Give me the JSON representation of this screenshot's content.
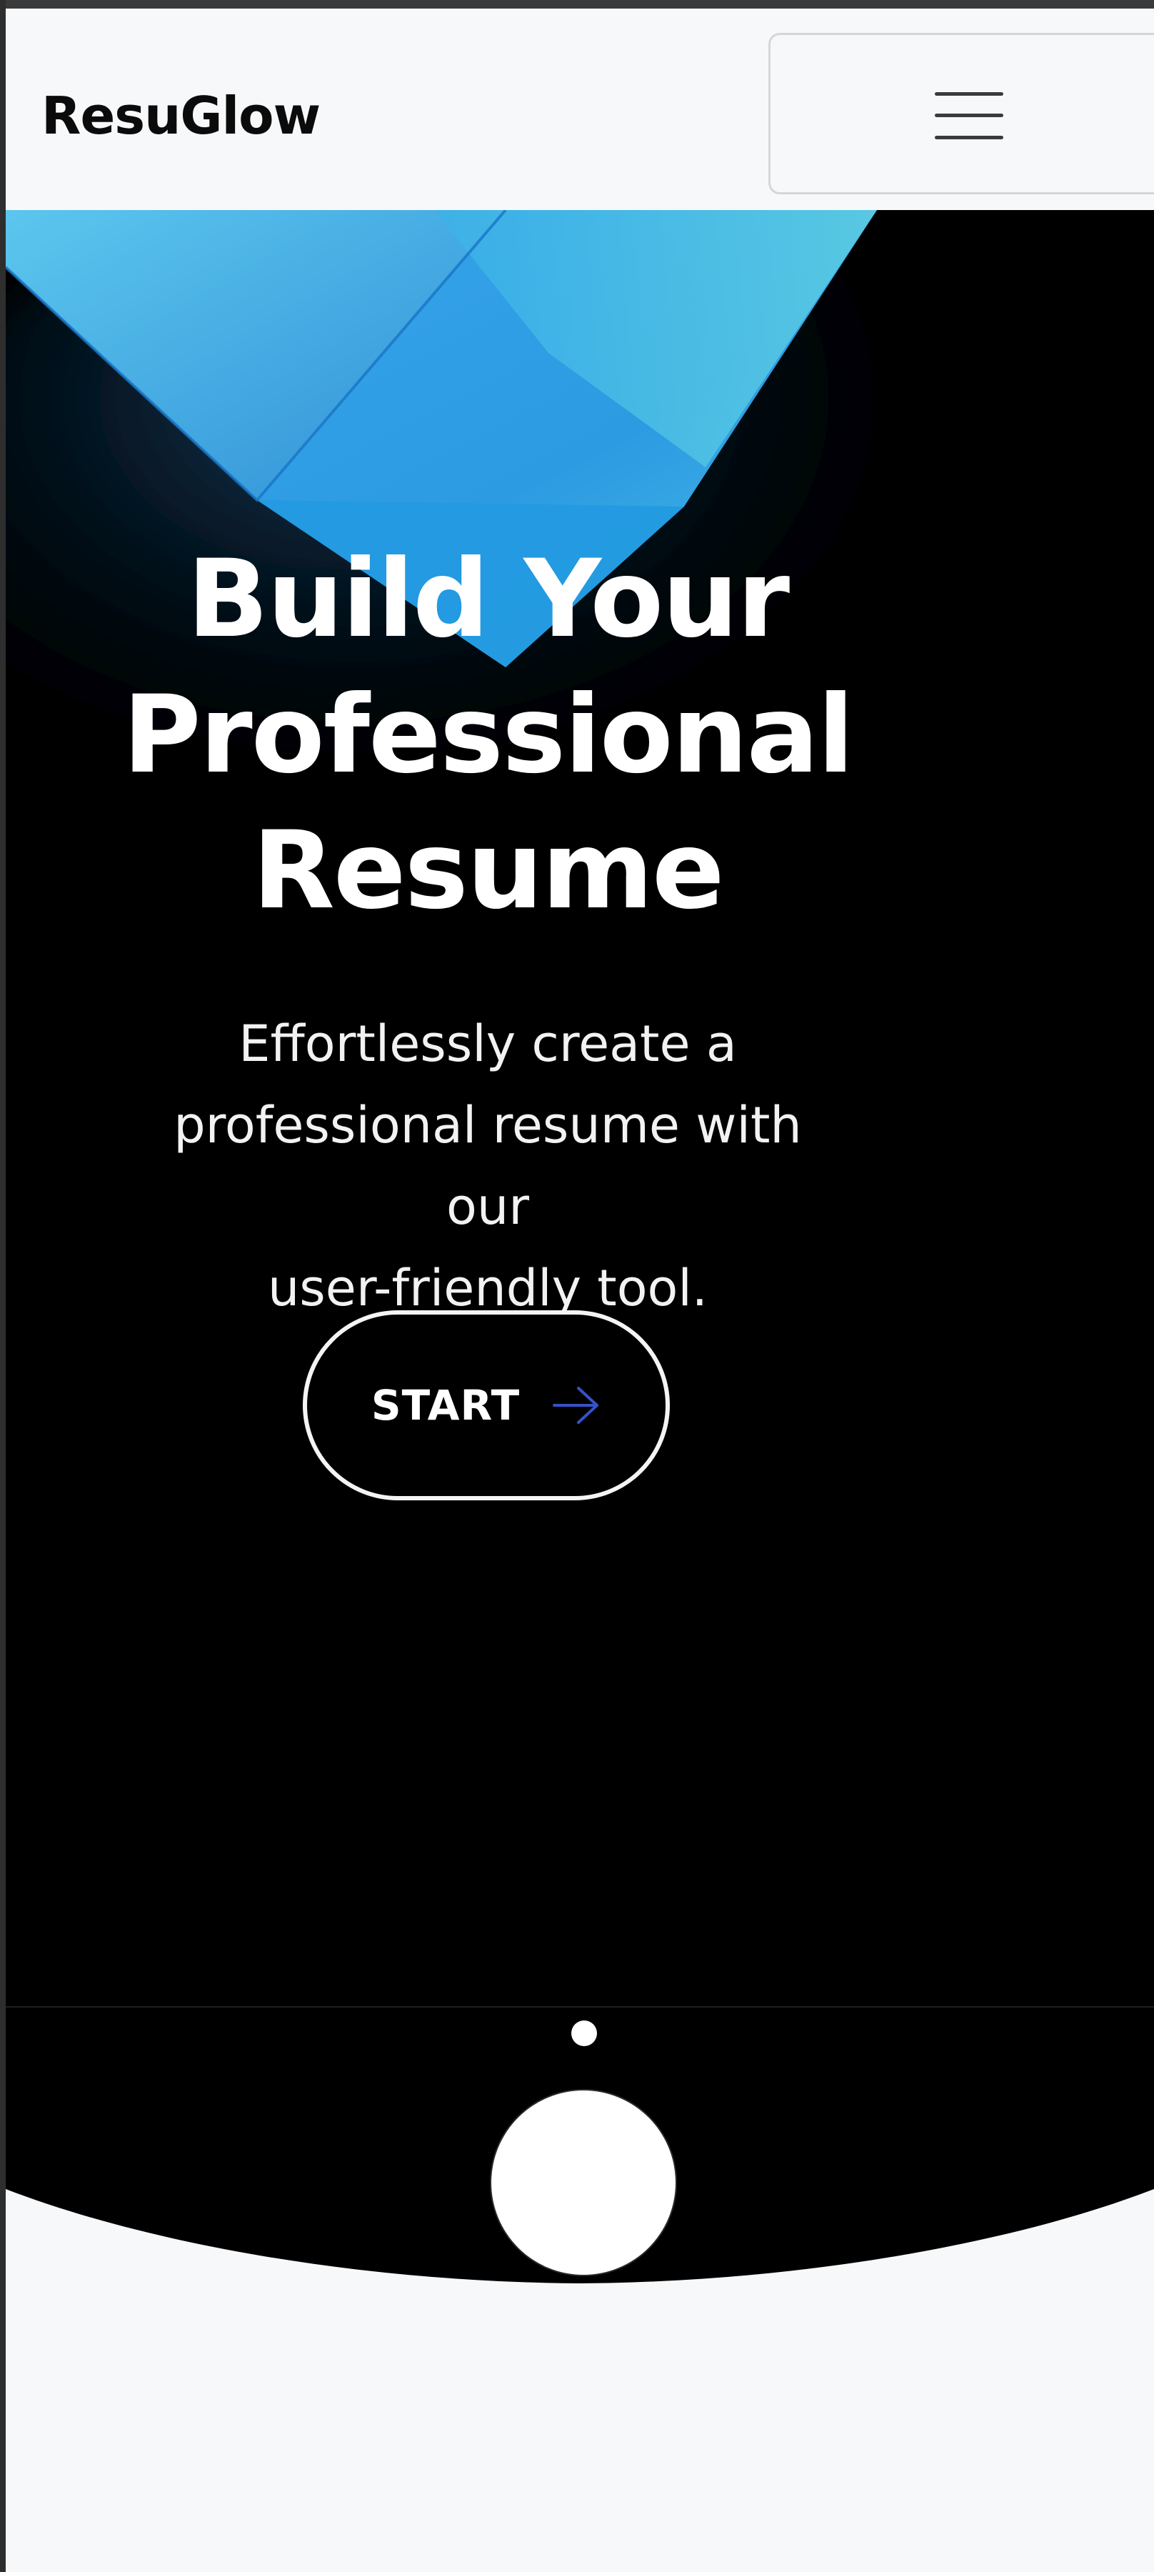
{
  "brand": {
    "name": "ResuGlow"
  },
  "nav": {
    "menu_icon": "hamburger-menu-icon"
  },
  "hero": {
    "headline_lines": [
      "Build Your",
      "Professional",
      "Resume"
    ],
    "subtitle_lines": [
      "Effortlessly create a",
      "professional resume with our",
      "user-friendly tool."
    ],
    "cta_label": "START",
    "cta_icon": "arrow-right-icon"
  },
  "carousel": {
    "indicator_icon": "dot-indicator",
    "action_icon": "circle-button"
  },
  "colors": {
    "page_background": "#f6f8fa",
    "hero_background": "#000000",
    "accent_blue": "#3ba7e8",
    "accent_cyan": "#56c4e0",
    "arrow_blue": "#3552c8",
    "text_dark": "#0b0b0b",
    "text_light": "#ffffff"
  }
}
